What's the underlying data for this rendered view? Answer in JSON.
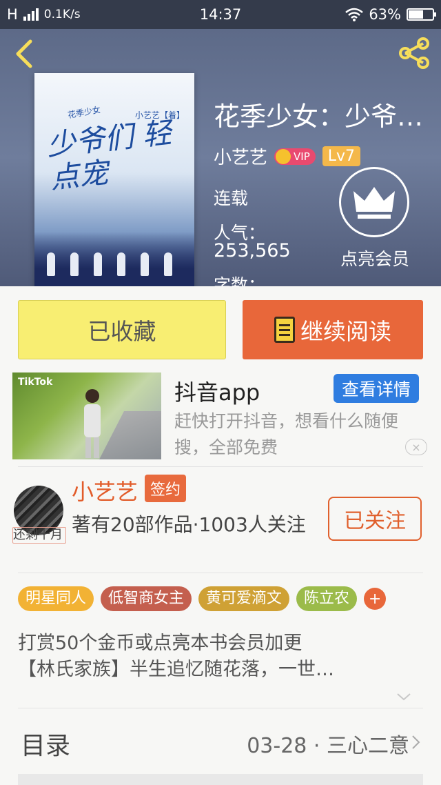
{
  "status_bar": {
    "network": "H",
    "speed": "0.1K/s",
    "time": "14:37",
    "battery": "63%",
    "battery_level": 0.63
  },
  "book": {
    "title": "花季少女：少爷…",
    "cover_title": "少爷们 轻点宠",
    "cover_series": "花季少女",
    "cover_author": "小艺艺【着】",
    "author": "小艺艺",
    "vip_label": "VIP",
    "level": "Lv7",
    "status": "连载",
    "popularity_label": "人气：",
    "popularity_value": "253,565",
    "word_count_label": "字数："
  },
  "member": {
    "label": "点亮会员"
  },
  "actions": {
    "favorite_label": "已收藏",
    "read_label": "继续阅读"
  },
  "ad": {
    "brand": "TikTok",
    "title": "抖音app",
    "button_label": "查看详情",
    "description": "赶快打开抖音，想看什么随便搜，全部免费",
    "close_glyph": "×"
  },
  "author_section": {
    "name": "小艺艺",
    "badge": "签约",
    "stats": "著有20部作品·1003人关注",
    "avatar_caption": "还剩十月",
    "follow_label": "已关注"
  },
  "tags": [
    {
      "label": "明星同人",
      "color": "#f2b234"
    },
    {
      "label": "低智商女主",
      "color": "#c45f4e"
    },
    {
      "label": "黄可爱滴文",
      "color": "#cfa135"
    },
    {
      "label": "陈立农",
      "color": "#9bbb4a"
    }
  ],
  "tag_add_label": "+",
  "notice": {
    "line1": "打赏50个金币或点亮本书会员加更",
    "line2": "【林氏家族】半生追忆随花落，一世…"
  },
  "toc": {
    "title": "目录",
    "latest": "03-28 · 三心二意"
  }
}
